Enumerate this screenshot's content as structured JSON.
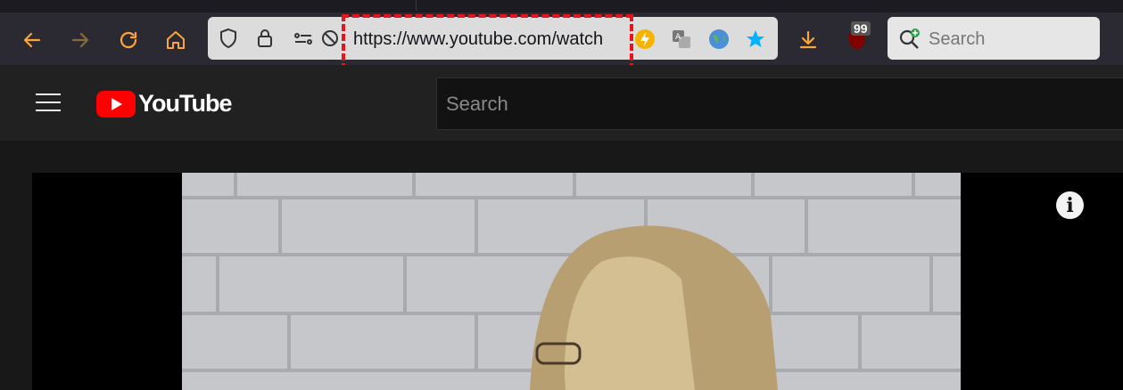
{
  "browser": {
    "url": "https://www.youtube.com/watch",
    "search_placeholder": "Search",
    "ublock_count": "99",
    "nav_icons": [
      "back-icon",
      "forward-icon",
      "reload-icon",
      "home-icon"
    ],
    "urlbar_icons": [
      "tracking-protection-icon",
      "lock-icon",
      "permissions-icon",
      "tracking-off-icon"
    ],
    "extension_icons": [
      "lightning-icon",
      "translate-icon",
      "globe-icon",
      "bookmark-star-icon"
    ],
    "colors": {
      "accent": "#ffa436",
      "highlight": "#e8141d",
      "star": "#00b2ff"
    }
  },
  "youtube": {
    "logo_text": "YouTube",
    "search_placeholder": "Search",
    "info_label": "i"
  }
}
